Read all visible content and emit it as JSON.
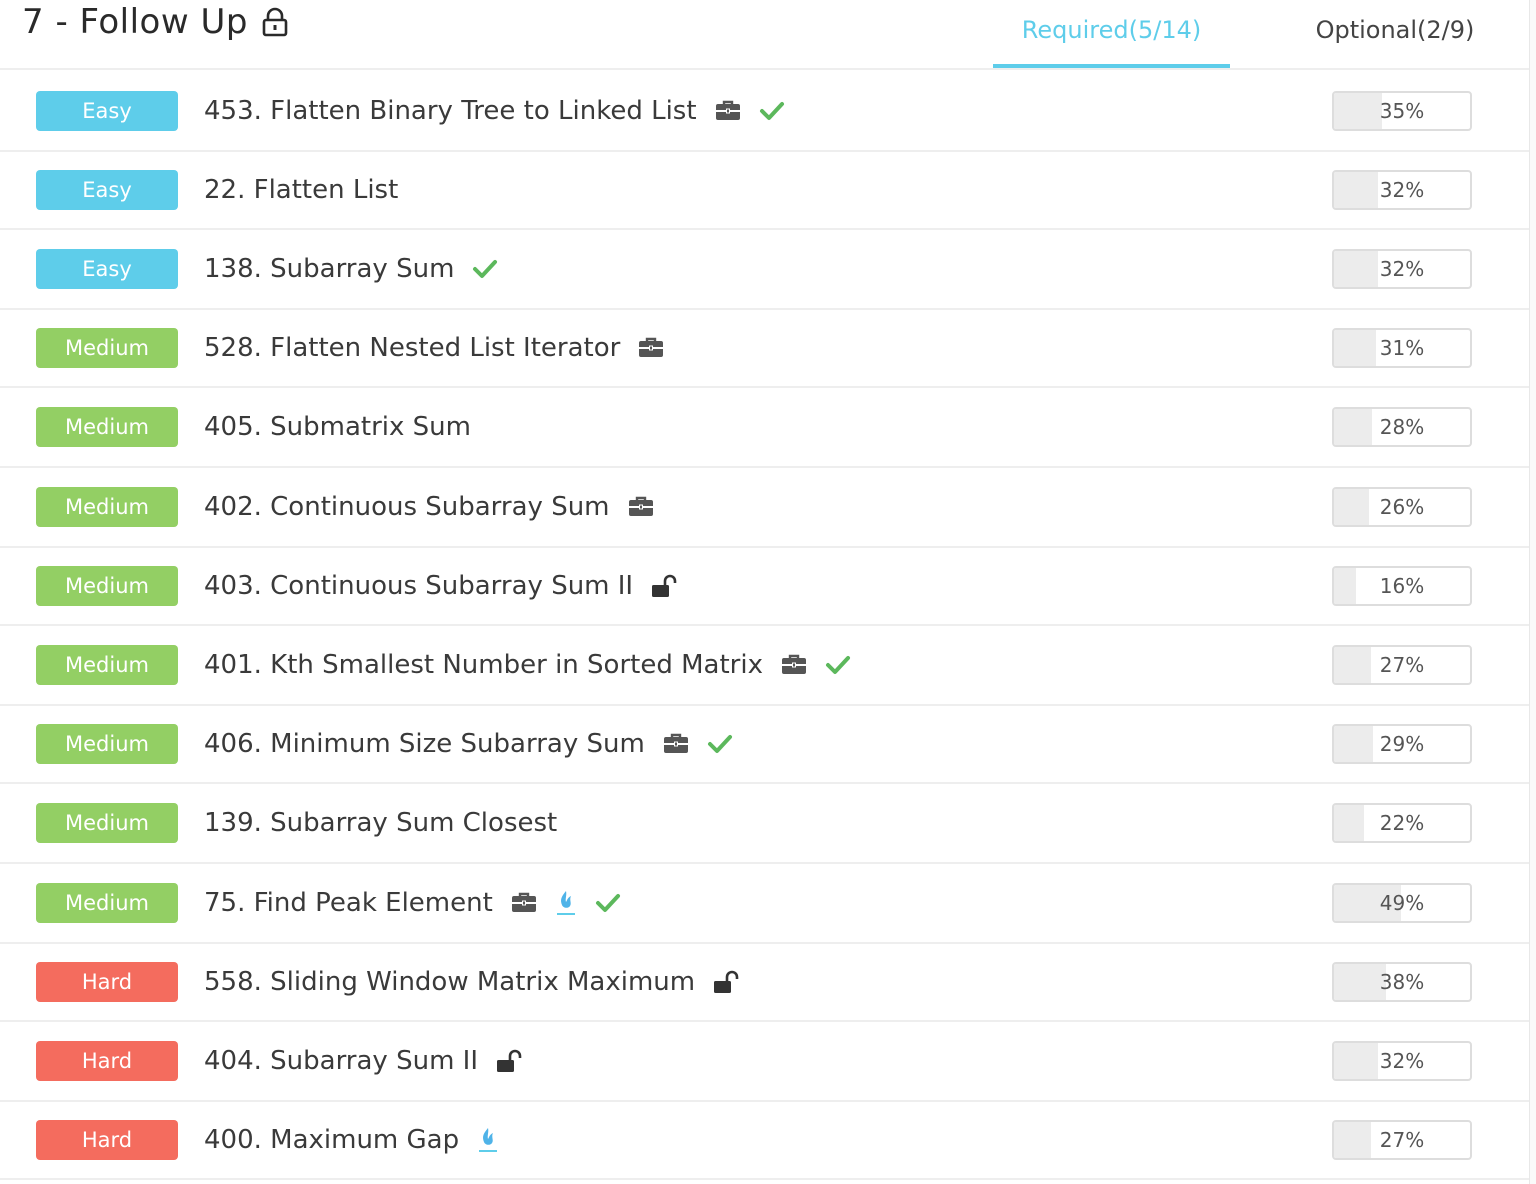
{
  "header": {
    "title": "7 - Follow Up",
    "tabs": [
      {
        "label": "Required(5/14)",
        "active": true
      },
      {
        "label": "Optional(2/9)",
        "active": false
      }
    ]
  },
  "colors": {
    "accent": "#5ecdea",
    "easy": "#5ecdea",
    "medium": "#93cf64",
    "hard": "#f46c5e",
    "check": "#5cb85c"
  },
  "problems": [
    {
      "difficulty": "Easy",
      "title": "453. Flatten Binary Tree to Linked List",
      "icons": [
        "briefcase-icon",
        "check-icon"
      ],
      "rate": "35%",
      "rate_value": 0.35
    },
    {
      "difficulty": "Easy",
      "title": "22. Flatten List",
      "icons": [],
      "rate": "32%",
      "rate_value": 0.32
    },
    {
      "difficulty": "Easy",
      "title": "138. Subarray Sum",
      "icons": [
        "check-icon"
      ],
      "rate": "32%",
      "rate_value": 0.32
    },
    {
      "difficulty": "Medium",
      "title": "528. Flatten Nested List Iterator",
      "icons": [
        "briefcase-icon"
      ],
      "rate": "31%",
      "rate_value": 0.31
    },
    {
      "difficulty": "Medium",
      "title": "405. Submatrix Sum",
      "icons": [],
      "rate": "28%",
      "rate_value": 0.28
    },
    {
      "difficulty": "Medium",
      "title": "402. Continuous Subarray Sum",
      "icons": [
        "briefcase-icon"
      ],
      "rate": "26%",
      "rate_value": 0.26
    },
    {
      "difficulty": "Medium",
      "title": "403. Continuous Subarray Sum II",
      "icons": [
        "unlock-icon"
      ],
      "rate": "16%",
      "rate_value": 0.16
    },
    {
      "difficulty": "Medium",
      "title": "401. Kth Smallest Number in Sorted Matrix",
      "icons": [
        "briefcase-icon",
        "check-icon"
      ],
      "rate": "27%",
      "rate_value": 0.27
    },
    {
      "difficulty": "Medium",
      "title": "406. Minimum Size Subarray Sum",
      "icons": [
        "briefcase-icon",
        "check-icon"
      ],
      "rate": "29%",
      "rate_value": 0.29
    },
    {
      "difficulty": "Medium",
      "title": "139. Subarray Sum Closest",
      "icons": [],
      "rate": "22%",
      "rate_value": 0.22
    },
    {
      "difficulty": "Medium",
      "title": "75. Find Peak Element",
      "icons": [
        "briefcase-icon",
        "flame-icon",
        "check-icon"
      ],
      "rate": "49%",
      "rate_value": 0.49
    },
    {
      "difficulty": "Hard",
      "title": "558. Sliding Window Matrix Maximum",
      "icons": [
        "unlock-icon"
      ],
      "rate": "38%",
      "rate_value": 0.38
    },
    {
      "difficulty": "Hard",
      "title": "404. Subarray Sum II",
      "icons": [
        "unlock-icon"
      ],
      "rate": "32%",
      "rate_value": 0.32
    },
    {
      "difficulty": "Hard",
      "title": "400. Maximum Gap",
      "icons": [
        "flame-icon"
      ],
      "rate": "27%",
      "rate_value": 0.27
    }
  ]
}
